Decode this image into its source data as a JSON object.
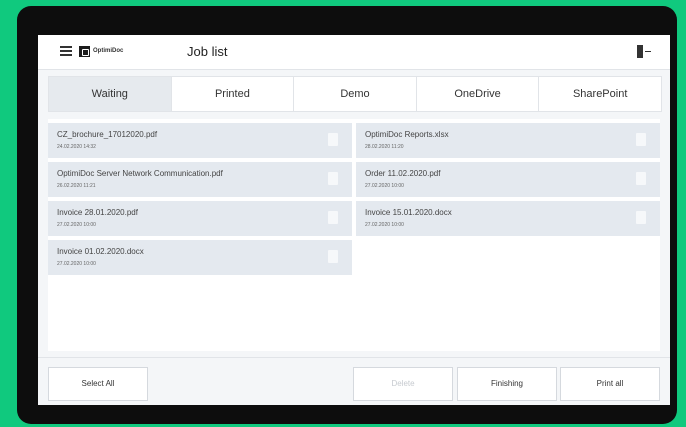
{
  "header": {
    "logo_text": "OptimiDoc",
    "title": "Job list"
  },
  "tabs": [
    {
      "label": "Waiting",
      "active": true
    },
    {
      "label": "Printed",
      "active": false
    },
    {
      "label": "Demo",
      "active": false
    },
    {
      "label": "OneDrive",
      "active": false
    },
    {
      "label": "SharePoint",
      "active": false
    }
  ],
  "jobs": [
    {
      "name": "CZ_brochure_17012020.pdf",
      "date": "24.02.2020 14:32"
    },
    {
      "name": "OptimiDoc Reports.xlsx",
      "date": "28.02.2020 11:20"
    },
    {
      "name": "OptimiDoc Server Network Communication.pdf",
      "date": "26.02.2020 11:21"
    },
    {
      "name": "Order 11.02.2020.pdf",
      "date": "27.02.2020 10:00"
    },
    {
      "name": "Invoice 28.01.2020.pdf",
      "date": "27.02.2020 10:00"
    },
    {
      "name": "Invoice 15.01.2020.docx",
      "date": "27.02.2020 10:00"
    },
    {
      "name": "Invoice 01.02.2020.docx",
      "date": "27.02.2020 10:00"
    }
  ],
  "footer": {
    "select_all": "Select All",
    "delete": "Delete",
    "finishing": "Finishing",
    "print_all": "Print all"
  }
}
